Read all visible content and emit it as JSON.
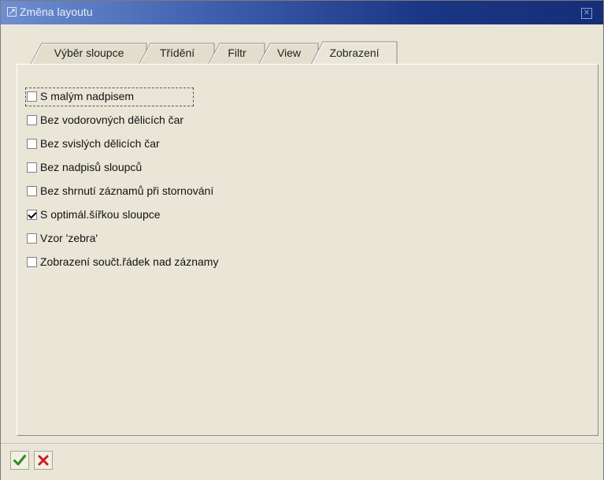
{
  "window": {
    "title": "Změna layoutu",
    "close_icon": "close-icon"
  },
  "tabs": [
    {
      "label": "Výběr sloupce",
      "active": false
    },
    {
      "label": "Třídění",
      "active": false
    },
    {
      "label": "Filtr",
      "active": false
    },
    {
      "label": "View",
      "active": false
    },
    {
      "label": "Zobrazení",
      "active": true
    }
  ],
  "options": [
    {
      "label": "S malým nadpisem",
      "checked": false,
      "focused": true
    },
    {
      "label": "Bez vodorovných dělicích čar",
      "checked": false
    },
    {
      "label": "Bez svislých dělicích čar",
      "checked": false
    },
    {
      "label": "Bez nadpisů sloupců",
      "checked": false
    },
    {
      "label": "Bez shrnutí záznamů při stornování",
      "checked": false
    },
    {
      "label": "S optimál.šířkou sloupce",
      "checked": true
    },
    {
      "label": "Vzor 'zebra'",
      "checked": false
    },
    {
      "label": "Zobrazení součt.řádek nad záznamy",
      "checked": false
    }
  ],
  "footer": {
    "confirm_icon": "checkmark-icon",
    "cancel_icon": "cross-icon",
    "confirm_color": "#2e8b1e",
    "cancel_color": "#c81e1e"
  },
  "colors": {
    "title_gradient_start": "#6e8fd0",
    "title_gradient_end": "#152e78",
    "panel": "#eae6d7"
  }
}
